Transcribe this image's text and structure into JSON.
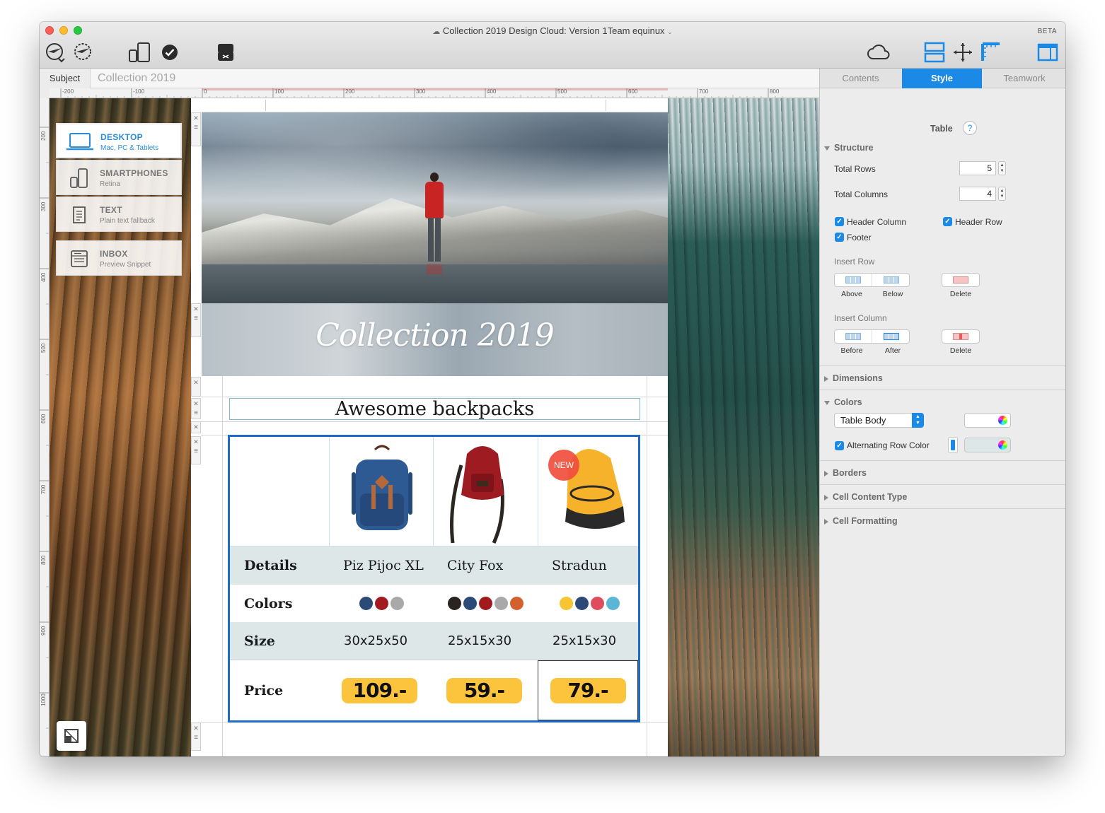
{
  "window": {
    "title": "Collection 2019 Design Cloud: Version 1Team equinux",
    "badge": "BETA"
  },
  "toolbar": {
    "icons": [
      "send-plane-icon",
      "schedule-plane-icon",
      "devices-icon",
      "checkmark-icon",
      "chat-icon",
      "cloud-icon",
      "layout-icon",
      "move-icon",
      "ruler-icon",
      "sidebar-icon"
    ]
  },
  "subject": {
    "label": "Subject",
    "value": "Collection 2019"
  },
  "ruler": {
    "top": [
      "-200",
      "-100",
      "0",
      "100",
      "200",
      "300",
      "400",
      "500",
      "600",
      "700",
      "800"
    ],
    "left": [
      "200",
      "300",
      "400",
      "500",
      "600",
      "700",
      "800",
      "900",
      "1000"
    ]
  },
  "views": [
    {
      "title": "DESKTOP",
      "subtitle": "Mac, PC & Tablets",
      "icon": "laptop-icon",
      "active": true
    },
    {
      "title": "SMARTPHONES",
      "subtitle": "Retina",
      "icon": "phone-icon",
      "active": false
    },
    {
      "title": "TEXT",
      "subtitle": "Plain text fallback",
      "icon": "document-icon",
      "active": false
    },
    {
      "title": "INBOX",
      "subtitle": "Preview Snippet",
      "icon": "inbox-icon",
      "active": false
    }
  ],
  "email": {
    "banner_title": "Collection 2019",
    "heading": "Awesome backpacks",
    "badge_new": "NEW",
    "table": {
      "header_label": "Details",
      "products": [
        "Piz Pijoc XL",
        "City Fox",
        "Stradun"
      ],
      "colors_label": "Colors",
      "colors": [
        [
          "#2b4a78",
          "#a31a1e",
          "#a9a9a9"
        ],
        [
          "#2b2320",
          "#2b4a78",
          "#a31a1e",
          "#a9a9a9",
          "#d2612e"
        ],
        [
          "#f6c531",
          "#2b4a78",
          "#e04b5d",
          "#5bb6d6"
        ]
      ],
      "size_label": "Size",
      "sizes": [
        "30x25x50",
        "25x15x30",
        "25x15x30"
      ],
      "price_label": "Price",
      "prices": [
        "109.-",
        "59.-",
        "79.-"
      ]
    }
  },
  "inspector": {
    "tabs": [
      "Contents",
      "Style",
      "Teamwork"
    ],
    "active_tab": "Style",
    "element_title": "Table",
    "help": "?",
    "structure": {
      "heading": "Structure",
      "total_rows_label": "Total Rows",
      "total_rows": "5",
      "total_columns_label": "Total Columns",
      "total_columns": "4",
      "header_column": "Header Column",
      "header_row": "Header Row",
      "footer": "Footer",
      "insert_row_label": "Insert Row",
      "insert_row_buttons": [
        "Above",
        "Below"
      ],
      "insert_column_label": "Insert Column",
      "insert_column_buttons": [
        "Before",
        "After"
      ],
      "delete_label": "Delete"
    },
    "sections": {
      "dimensions": "Dimensions",
      "colors": "Colors",
      "borders": "Borders",
      "cell_content_type": "Cell Content Type",
      "cell_formatting": "Cell Formatting"
    },
    "colors": {
      "target": "Table Body",
      "alternating_row_color": "Alternating Row Color",
      "alternating_color_hex": "#dde7e8"
    }
  },
  "accent": "#1a8ae6",
  "table_border": "#1e6ac8",
  "price_bg": "#fcc43c",
  "stripe": "#dde7e8"
}
